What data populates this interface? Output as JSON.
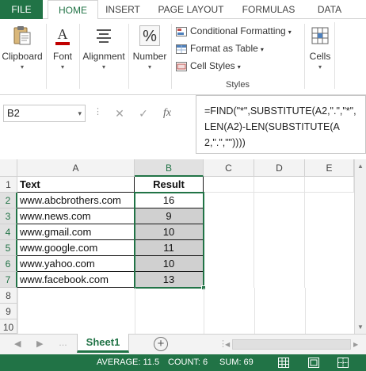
{
  "tabs": {
    "file": "FILE",
    "home": "HOME",
    "insert": "INSERT",
    "page_layout": "PAGE LAYOUT",
    "formulas": "FORMULAS",
    "data": "DATA"
  },
  "ribbon": {
    "clipboard": "Clipboard",
    "font": "Font",
    "alignment": "Alignment",
    "number": "Number",
    "conditional_formatting": "Conditional Formatting",
    "format_as_table": "Format as Table",
    "cell_styles": "Cell Styles",
    "styles": "Styles",
    "cells": "Cells",
    "number_icon": "%"
  },
  "formula_bar": {
    "name_box": "B2",
    "fx": "fx",
    "cancel": "✕",
    "enter": "✓",
    "formula": "=FIND(\"*\",SUBSTITUTE(A2,\".\",\"*\",LEN(A2)-LEN(SUBSTITUTE(A2,\".\",\"\"))))"
  },
  "grid": {
    "columns": [
      "A",
      "B",
      "C",
      "D",
      "E"
    ],
    "rows": [
      "1",
      "2",
      "3",
      "4",
      "5",
      "6",
      "7",
      "8",
      "9",
      "10"
    ],
    "header": {
      "text": "Text",
      "result": "Result"
    },
    "data": [
      {
        "text": "www.abcbrothers.com",
        "result": "16"
      },
      {
        "text": "www.news.com",
        "result": "9"
      },
      {
        "text": "www.gmail.com",
        "result": "10"
      },
      {
        "text": "www.google.com",
        "result": "11"
      },
      {
        "text": "www.yahoo.com",
        "result": "10"
      },
      {
        "text": "www.facebook.com",
        "result": "13"
      }
    ]
  },
  "sheets": {
    "active": "Sheet1",
    "add": "+"
  },
  "status": {
    "average": "AVERAGE: 11.5",
    "count": "COUNT: 6",
    "sum": "SUM: 69"
  },
  "colors": {
    "accent": "#217346",
    "selected_fill": "#d0d0d0"
  }
}
